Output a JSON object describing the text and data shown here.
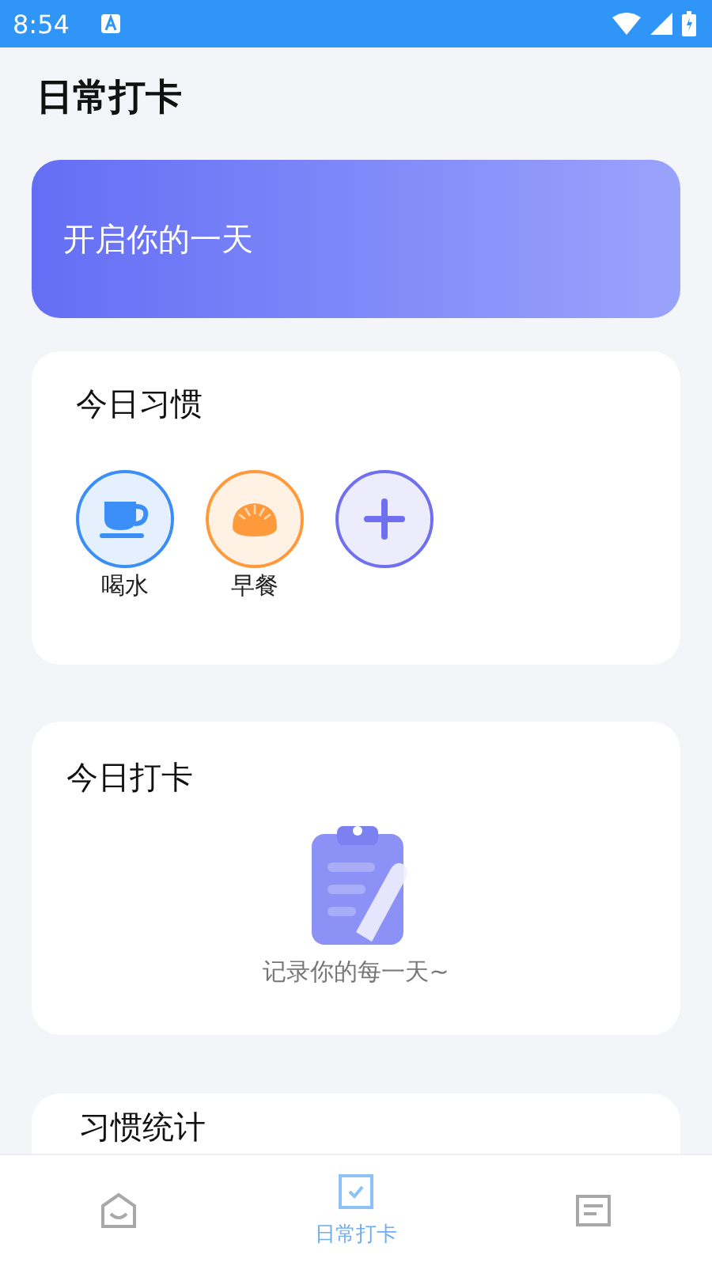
{
  "status_bar": {
    "time": "8:54"
  },
  "header": {
    "title": "日常打卡"
  },
  "banner": {
    "text": "开启你的一天"
  },
  "habits_card": {
    "title": "今日习惯",
    "items": [
      {
        "kind": "habit",
        "label": "喝水",
        "color": "#3a8ef6"
      },
      {
        "kind": "habit",
        "label": "早餐",
        "color": "#ff9a3c"
      },
      {
        "kind": "add",
        "color": "#6f6ff0"
      }
    ]
  },
  "checkin_card": {
    "title": "今日打卡",
    "empty_text": "记录你的每一天~"
  },
  "stats_card": {
    "title": "习惯统计"
  },
  "tab_bar": [
    {
      "selected": false
    },
    {
      "label": "日常打卡",
      "selected": true
    },
    {
      "selected": false
    }
  ]
}
